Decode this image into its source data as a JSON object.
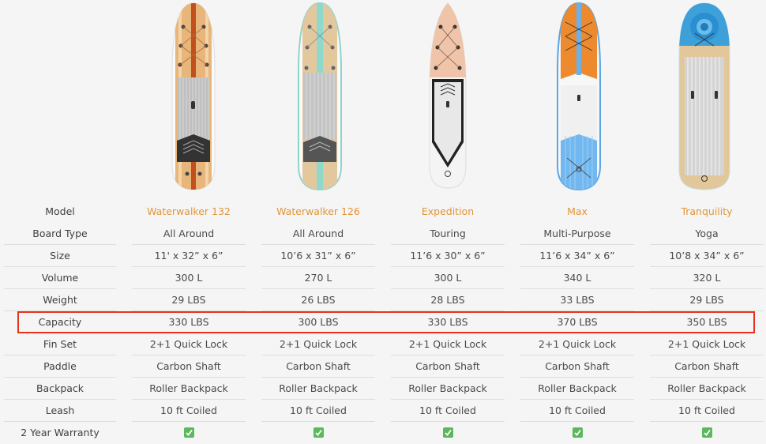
{
  "accent_color": "#e0963a",
  "highlight_color": "#e8331c",
  "boards": [
    {
      "name": "Waterwalker 132",
      "style": "wood-orange"
    },
    {
      "name": "Waterwalker 126",
      "style": "wood-teal"
    },
    {
      "name": "Expedition",
      "style": "touring-peach"
    },
    {
      "name": "Max",
      "style": "orange-blue"
    },
    {
      "name": "Tranquility",
      "style": "yoga-mandala"
    }
  ],
  "table": {
    "highlighted_row": "Capacity",
    "rows": [
      {
        "label": "Model",
        "values": [
          "Waterwalker 132",
          "Waterwalker 126",
          "Expedition",
          "Max",
          "Tranquility"
        ]
      },
      {
        "label": "Board Type",
        "values": [
          "All Around",
          "All Around",
          "Touring",
          "Multi-Purpose",
          "Yoga"
        ]
      },
      {
        "label": "Size",
        "values": [
          "11' x 32” x 6”",
          "10’6 x 31” x 6”",
          "11’6 x 30” x 6”",
          "11’6 x 34” x 6”",
          "10’8 x 34” x 6”"
        ]
      },
      {
        "label": "Volume",
        "values": [
          "300 L",
          "270 L",
          "300 L",
          "340 L",
          "320 L"
        ]
      },
      {
        "label": "Weight",
        "values": [
          "29 LBS",
          "26 LBS",
          "28 LBS",
          "33 LBS",
          "29 LBS"
        ]
      },
      {
        "label": "Capacity",
        "values": [
          "330 LBS",
          "300 LBS",
          "330 LBS",
          "370 LBS",
          "350 LBS"
        ]
      },
      {
        "label": "Fin Set",
        "values": [
          "2+1 Quick Lock",
          "2+1 Quick Lock",
          "2+1 Quick Lock",
          "2+1 Quick Lock",
          "2+1 Quick Lock"
        ]
      },
      {
        "label": "Paddle",
        "values": [
          "Carbon Shaft",
          "Carbon Shaft",
          "Carbon Shaft",
          "Carbon Shaft",
          "Carbon Shaft"
        ]
      },
      {
        "label": "Backpack",
        "values": [
          "Roller Backpack",
          "Roller Backpack",
          "Roller Backpack",
          "Roller Backpack",
          "Roller Backpack"
        ]
      },
      {
        "label": "Leash",
        "values": [
          "10 ft Coiled",
          "10 ft Coiled",
          "10 ft Coiled",
          "10 ft Coiled",
          "10 ft Coiled"
        ]
      },
      {
        "label": "2 Year Warranty",
        "values": [
          "check-icon",
          "check-icon",
          "check-icon",
          "check-icon",
          "check-icon"
        ]
      }
    ]
  }
}
